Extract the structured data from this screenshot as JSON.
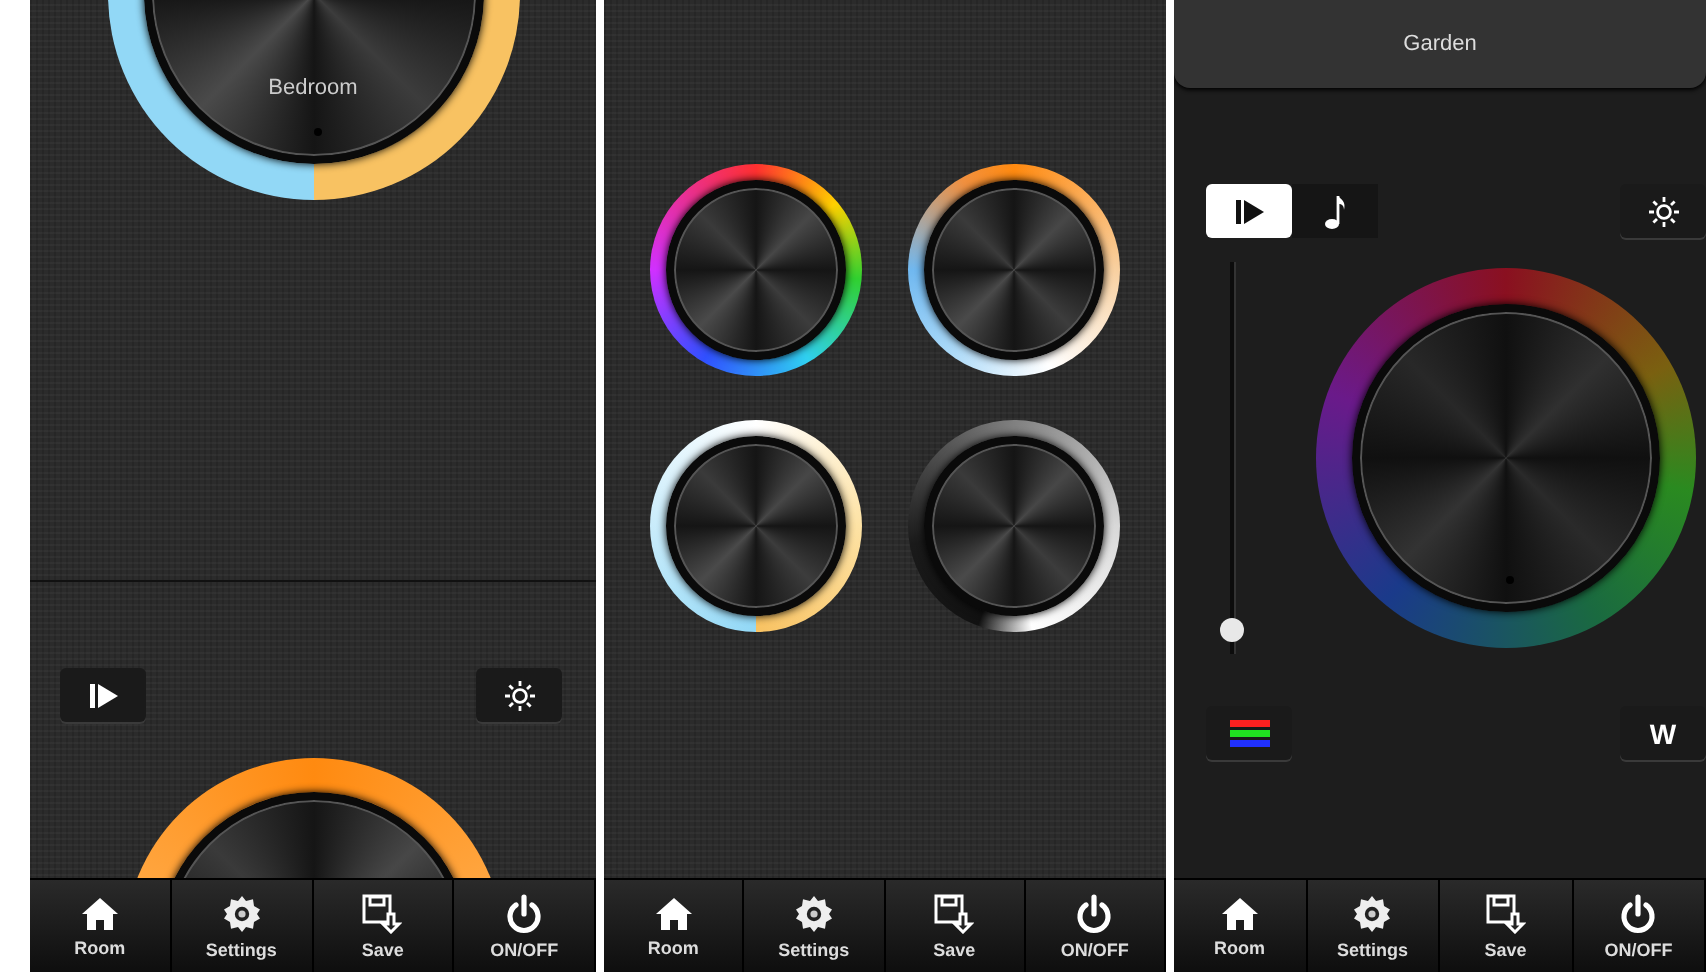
{
  "screens": [
    {
      "kind": "white_balance",
      "wheels": [
        {
          "kind": "split",
          "label": "Bedroom"
        },
        {
          "kind": "orange"
        }
      ],
      "tab_bar": [
        "Room",
        "Settings",
        "Save",
        "ON/OFF"
      ]
    },
    {
      "kind": "presets",
      "wheels": [
        {
          "kind": "rainbow"
        },
        {
          "kind": "warm"
        },
        {
          "kind": "white"
        },
        {
          "kind": "gray"
        }
      ],
      "tab_bar": [
        "Room",
        "Settings",
        "Save",
        "ON/OFF"
      ]
    },
    {
      "kind": "rgb",
      "header": "Garden",
      "mode_toggle": [
        {
          "selected": true
        },
        {
          "selected": false
        }
      ],
      "slider": {
        "level": 0.03
      },
      "wheels": [
        {
          "kind": "dim_rainbow"
        }
      ],
      "white_button": "W",
      "tab_bar": [
        "Room",
        "Settings",
        "Save",
        "ON/OFF"
      ]
    }
  ]
}
